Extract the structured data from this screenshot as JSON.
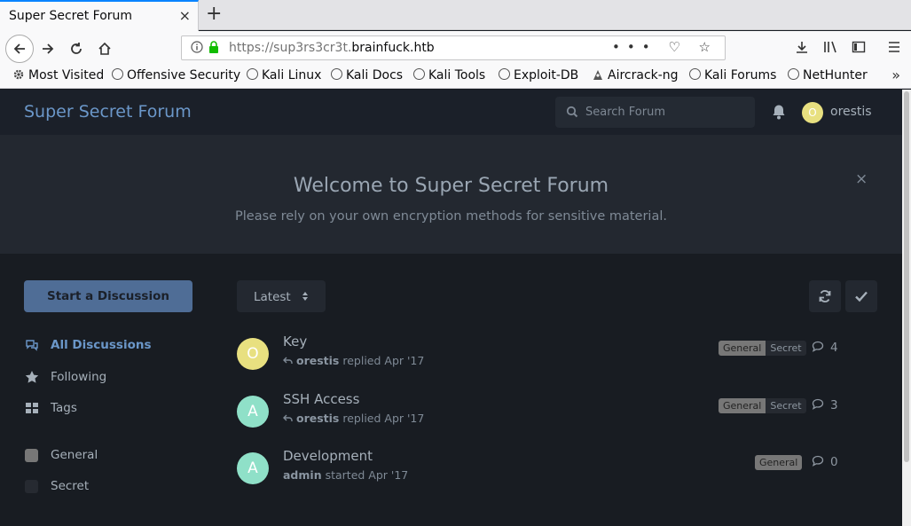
{
  "browser": {
    "tab_title": "Super Secret Forum",
    "tab_close": "×",
    "new_tab": "+",
    "url_prefix": "https://sup3rs3cr3t.",
    "url_host": "brainfuck.htb",
    "url_actions": "••• ♡ ☆",
    "bookmarks": [
      {
        "label": "Most Visited",
        "icon": "gear-icon"
      },
      {
        "label": "Offensive Security",
        "icon": "globe-icon"
      },
      {
        "label": "Kali Linux",
        "icon": "globe-icon"
      },
      {
        "label": "Kali Docs",
        "icon": "globe-icon"
      },
      {
        "label": "Kali Tools",
        "icon": "globe-icon"
      },
      {
        "label": "Exploit-DB",
        "icon": "globe-icon"
      },
      {
        "label": "Aircrack-ng",
        "icon": "aircrack-icon"
      },
      {
        "label": "Kali Forums",
        "icon": "globe-icon"
      },
      {
        "label": "NetHunter",
        "icon": "globe-icon"
      }
    ],
    "bookmarks_more": "»"
  },
  "forum": {
    "brand": "Super Secret Forum",
    "search_placeholder": "Search Forum",
    "user": {
      "name": "orestis",
      "initial": "O"
    },
    "hero": {
      "title": "Welcome to Super Secret Forum",
      "subtitle": "Please rely on your own encryption methods for sensitive material.",
      "close": "×"
    },
    "start_discussion": "Start a Discussion",
    "nav": {
      "all_discussions": "All Discussions",
      "following": "Following",
      "tags": "Tags"
    },
    "tag_list": {
      "general": {
        "label": "General",
        "color": "#777777"
      },
      "secret": {
        "label": "Secret",
        "color": "#262a31"
      }
    },
    "sort_label": "Latest",
    "discussions": [
      {
        "title": "Key",
        "avatar": "O",
        "avatar_color": "#e8e080",
        "author": "orestis",
        "action": "replied Apr '17",
        "tags": [
          "General",
          "Secret"
        ],
        "replies": "4"
      },
      {
        "title": "SSH Access",
        "avatar": "A",
        "avatar_color": "#8fe0c8",
        "author": "orestis",
        "action": "replied Apr '17",
        "tags": [
          "General",
          "Secret"
        ],
        "replies": "3"
      },
      {
        "title": "Development",
        "avatar": "A",
        "avatar_color": "#8fe0c8",
        "author": "admin",
        "action": "started Apr '17",
        "tags": [
          "General"
        ],
        "replies": "0"
      }
    ]
  }
}
